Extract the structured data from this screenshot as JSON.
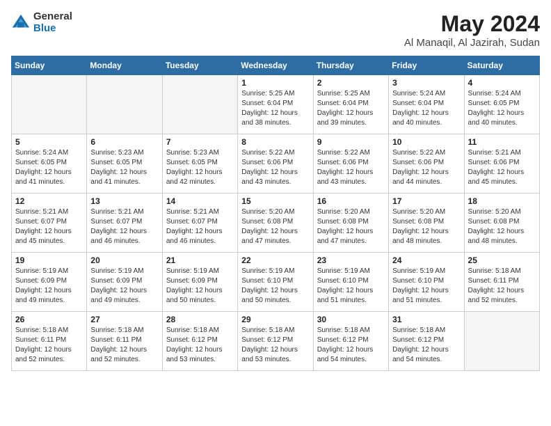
{
  "header": {
    "logo_general": "General",
    "logo_blue": "Blue",
    "title": "May 2024",
    "location": "Al Manaqil, Al Jazirah, Sudan"
  },
  "days_of_week": [
    "Sunday",
    "Monday",
    "Tuesday",
    "Wednesday",
    "Thursday",
    "Friday",
    "Saturday"
  ],
  "weeks": [
    [
      {
        "day": "",
        "info": ""
      },
      {
        "day": "",
        "info": ""
      },
      {
        "day": "",
        "info": ""
      },
      {
        "day": "1",
        "info": "Sunrise: 5:25 AM\nSunset: 6:04 PM\nDaylight: 12 hours\nand 38 minutes."
      },
      {
        "day": "2",
        "info": "Sunrise: 5:25 AM\nSunset: 6:04 PM\nDaylight: 12 hours\nand 39 minutes."
      },
      {
        "day": "3",
        "info": "Sunrise: 5:24 AM\nSunset: 6:04 PM\nDaylight: 12 hours\nand 40 minutes."
      },
      {
        "day": "4",
        "info": "Sunrise: 5:24 AM\nSunset: 6:05 PM\nDaylight: 12 hours\nand 40 minutes."
      }
    ],
    [
      {
        "day": "5",
        "info": "Sunrise: 5:24 AM\nSunset: 6:05 PM\nDaylight: 12 hours\nand 41 minutes."
      },
      {
        "day": "6",
        "info": "Sunrise: 5:23 AM\nSunset: 6:05 PM\nDaylight: 12 hours\nand 41 minutes."
      },
      {
        "day": "7",
        "info": "Sunrise: 5:23 AM\nSunset: 6:05 PM\nDaylight: 12 hours\nand 42 minutes."
      },
      {
        "day": "8",
        "info": "Sunrise: 5:22 AM\nSunset: 6:06 PM\nDaylight: 12 hours\nand 43 minutes."
      },
      {
        "day": "9",
        "info": "Sunrise: 5:22 AM\nSunset: 6:06 PM\nDaylight: 12 hours\nand 43 minutes."
      },
      {
        "day": "10",
        "info": "Sunrise: 5:22 AM\nSunset: 6:06 PM\nDaylight: 12 hours\nand 44 minutes."
      },
      {
        "day": "11",
        "info": "Sunrise: 5:21 AM\nSunset: 6:06 PM\nDaylight: 12 hours\nand 45 minutes."
      }
    ],
    [
      {
        "day": "12",
        "info": "Sunrise: 5:21 AM\nSunset: 6:07 PM\nDaylight: 12 hours\nand 45 minutes."
      },
      {
        "day": "13",
        "info": "Sunrise: 5:21 AM\nSunset: 6:07 PM\nDaylight: 12 hours\nand 46 minutes."
      },
      {
        "day": "14",
        "info": "Sunrise: 5:21 AM\nSunset: 6:07 PM\nDaylight: 12 hours\nand 46 minutes."
      },
      {
        "day": "15",
        "info": "Sunrise: 5:20 AM\nSunset: 6:08 PM\nDaylight: 12 hours\nand 47 minutes."
      },
      {
        "day": "16",
        "info": "Sunrise: 5:20 AM\nSunset: 6:08 PM\nDaylight: 12 hours\nand 47 minutes."
      },
      {
        "day": "17",
        "info": "Sunrise: 5:20 AM\nSunset: 6:08 PM\nDaylight: 12 hours\nand 48 minutes."
      },
      {
        "day": "18",
        "info": "Sunrise: 5:20 AM\nSunset: 6:08 PM\nDaylight: 12 hours\nand 48 minutes."
      }
    ],
    [
      {
        "day": "19",
        "info": "Sunrise: 5:19 AM\nSunset: 6:09 PM\nDaylight: 12 hours\nand 49 minutes."
      },
      {
        "day": "20",
        "info": "Sunrise: 5:19 AM\nSunset: 6:09 PM\nDaylight: 12 hours\nand 49 minutes."
      },
      {
        "day": "21",
        "info": "Sunrise: 5:19 AM\nSunset: 6:09 PM\nDaylight: 12 hours\nand 50 minutes."
      },
      {
        "day": "22",
        "info": "Sunrise: 5:19 AM\nSunset: 6:10 PM\nDaylight: 12 hours\nand 50 minutes."
      },
      {
        "day": "23",
        "info": "Sunrise: 5:19 AM\nSunset: 6:10 PM\nDaylight: 12 hours\nand 51 minutes."
      },
      {
        "day": "24",
        "info": "Sunrise: 5:19 AM\nSunset: 6:10 PM\nDaylight: 12 hours\nand 51 minutes."
      },
      {
        "day": "25",
        "info": "Sunrise: 5:18 AM\nSunset: 6:11 PM\nDaylight: 12 hours\nand 52 minutes."
      }
    ],
    [
      {
        "day": "26",
        "info": "Sunrise: 5:18 AM\nSunset: 6:11 PM\nDaylight: 12 hours\nand 52 minutes."
      },
      {
        "day": "27",
        "info": "Sunrise: 5:18 AM\nSunset: 6:11 PM\nDaylight: 12 hours\nand 52 minutes."
      },
      {
        "day": "28",
        "info": "Sunrise: 5:18 AM\nSunset: 6:12 PM\nDaylight: 12 hours\nand 53 minutes."
      },
      {
        "day": "29",
        "info": "Sunrise: 5:18 AM\nSunset: 6:12 PM\nDaylight: 12 hours\nand 53 minutes."
      },
      {
        "day": "30",
        "info": "Sunrise: 5:18 AM\nSunset: 6:12 PM\nDaylight: 12 hours\nand 54 minutes."
      },
      {
        "day": "31",
        "info": "Sunrise: 5:18 AM\nSunset: 6:12 PM\nDaylight: 12 hours\nand 54 minutes."
      },
      {
        "day": "",
        "info": ""
      }
    ]
  ]
}
